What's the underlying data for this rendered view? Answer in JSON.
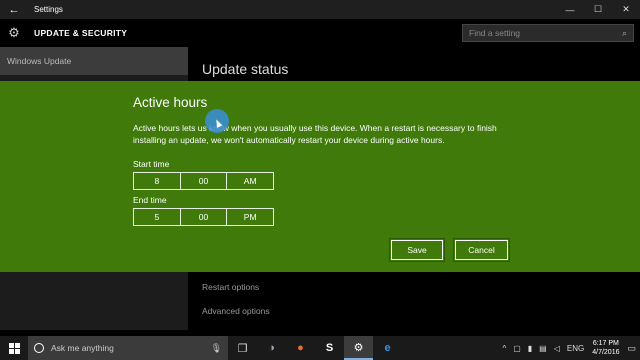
{
  "window": {
    "title": "Settings",
    "back_icon": "arrow-left-icon",
    "minimize": "—",
    "maximize": "☐",
    "close": "✕"
  },
  "header": {
    "section": "UPDATE & SECURITY",
    "search_placeholder": "Find a setting",
    "search_icon": "⌕"
  },
  "sidebar": {
    "items": [
      {
        "label": "Windows Update",
        "active": true
      }
    ]
  },
  "main": {
    "title": "Update status",
    "links": [
      "Restart options",
      "Advanced options"
    ]
  },
  "dialog": {
    "title": "Active hours",
    "description": "Active hours lets us know when you usually use this device. When a restart is necessary to finish installing an update, we won't automatically restart your device during active hours.",
    "start": {
      "label": "Start time",
      "hour": "8",
      "minute": "00",
      "period": "AM"
    },
    "end": {
      "label": "End time",
      "hour": "5",
      "minute": "00",
      "period": "PM"
    },
    "save_label": "Save",
    "cancel_label": "Cancel",
    "background_color": "#3f7a0a"
  },
  "taskbar": {
    "search_placeholder": "Ask me anything",
    "apps": [
      {
        "name": "task-view-icon",
        "glyph": "❐",
        "active": false
      },
      {
        "name": "app-icon",
        "glyph": "◑",
        "active": false
      },
      {
        "name": "firefox-icon",
        "glyph": "●",
        "active": false
      },
      {
        "name": "skype-icon",
        "glyph": "S",
        "active": false
      },
      {
        "name": "settings-icon",
        "glyph": "⚙",
        "active": true
      },
      {
        "name": "edge-icon",
        "glyph": "e",
        "active": false
      }
    ],
    "tray": {
      "language": "ENG",
      "time": "6:17 PM",
      "date": "4/7/2016"
    }
  }
}
